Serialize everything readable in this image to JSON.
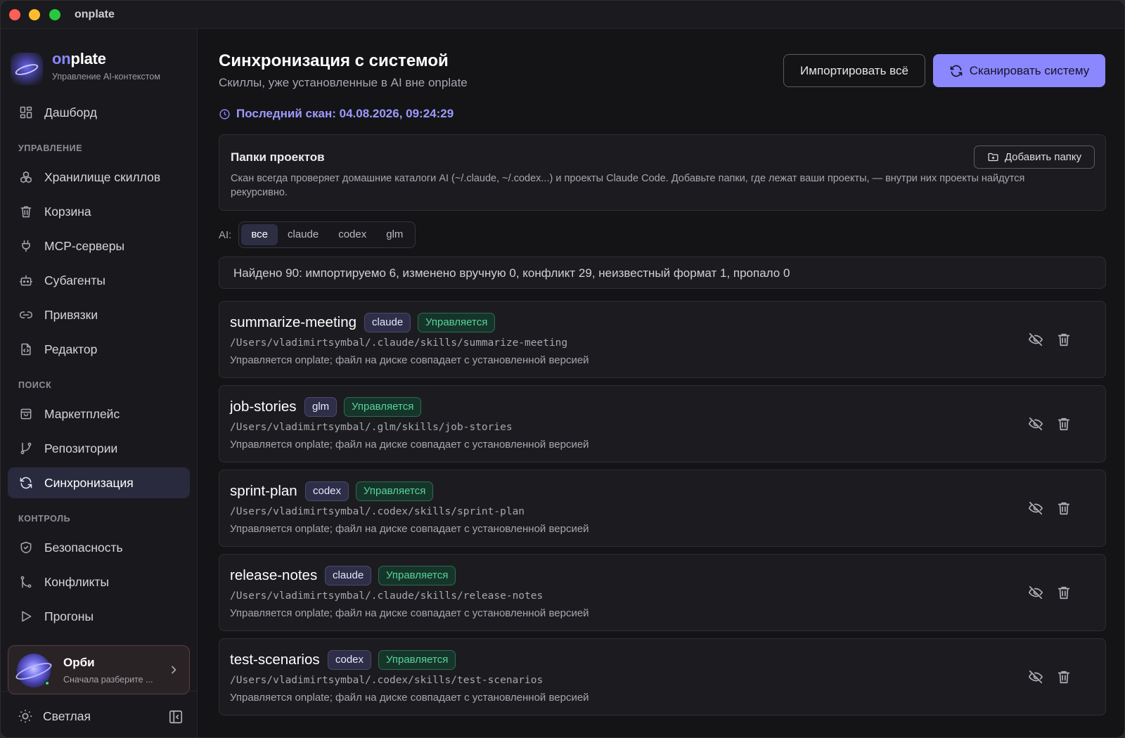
{
  "window": {
    "title": "onplate"
  },
  "brand": {
    "name_accent": "on",
    "name_rest": "plate",
    "subtitle": "Управление AI-контекстом"
  },
  "nav": {
    "dashboard": "Дашборд",
    "sections": {
      "manage": "УПРАВЛЕНИЕ",
      "search": "ПОИСК",
      "control": "КОНТРОЛЬ"
    },
    "items": [
      {
        "id": "skills-store",
        "label": "Хранилище скиллов",
        "icon": "cubes-icon"
      },
      {
        "id": "trash",
        "label": "Корзина",
        "icon": "trash-icon"
      },
      {
        "id": "mcp",
        "label": "MCP-серверы",
        "icon": "plug-icon"
      },
      {
        "id": "subagents",
        "label": "Субагенты",
        "icon": "bot-icon"
      },
      {
        "id": "bindings",
        "label": "Привязки",
        "icon": "link-icon"
      },
      {
        "id": "editor",
        "label": "Редактор",
        "icon": "file-code-icon"
      },
      {
        "id": "marketplace",
        "label": "Маркетплейс",
        "icon": "shopping-bag-icon"
      },
      {
        "id": "repos",
        "label": "Репозитории",
        "icon": "git-branch-icon"
      },
      {
        "id": "sync",
        "label": "Синхронизация",
        "icon": "refresh-icon",
        "active": true
      },
      {
        "id": "security",
        "label": "Безопасность",
        "icon": "shield-icon"
      },
      {
        "id": "conflicts",
        "label": "Конфликты",
        "icon": "git-merge-icon"
      },
      {
        "id": "runs",
        "label": "Прогоны",
        "icon": "play-icon"
      }
    ]
  },
  "orbi": {
    "name": "Орби",
    "subtitle": "Сначала разберите ..."
  },
  "theme": {
    "label": "Светлая"
  },
  "page": {
    "title": "Синхронизация с системой",
    "subtitle": "Скиллы, уже установленные в AI вне onplate",
    "import_all": "Импортировать всё",
    "scan": "Сканировать систему",
    "last_scan": "Последний скан: 04.08.2026, 09:24:29"
  },
  "folders": {
    "title": "Папки проектов",
    "add": "Добавить папку",
    "description": "Скан всегда проверяет домашние каталоги AI (~/.claude, ~/.codex...) и проекты Claude Code. Добавьте папки, где лежат ваши проекты, — внутри них проекты найдутся рекурсивно."
  },
  "filter": {
    "label": "AI:",
    "options": [
      "все",
      "claude",
      "codex",
      "glm"
    ],
    "selected": "все"
  },
  "summary": "Найдено 90: импортируемо 6, изменено вручную 0, конфликт 29, неизвестный формат 1, пропало 0",
  "skills": [
    {
      "name": "summarize-meeting",
      "ai": "claude",
      "status": "Управляется",
      "path": "/Users/vladimirtsymbal/.claude/skills/summarize-meeting",
      "desc": "Управляется onplate; файл на диске совпадает с установленной версией"
    },
    {
      "name": "job-stories",
      "ai": "glm",
      "status": "Управляется",
      "path": "/Users/vladimirtsymbal/.glm/skills/job-stories",
      "desc": "Управляется onplate; файл на диске совпадает с установленной версией"
    },
    {
      "name": "sprint-plan",
      "ai": "codex",
      "status": "Управляется",
      "path": "/Users/vladimirtsymbal/.codex/skills/sprint-plan",
      "desc": "Управляется onplate; файл на диске совпадает с установленной версией"
    },
    {
      "name": "release-notes",
      "ai": "claude",
      "status": "Управляется",
      "path": "/Users/vladimirtsymbal/.claude/skills/release-notes",
      "desc": "Управляется onplate; файл на диске совпадает с установленной версией"
    },
    {
      "name": "test-scenarios",
      "ai": "codex",
      "status": "Управляется",
      "path": "/Users/vladimirtsymbal/.codex/skills/test-scenarios",
      "desc": "Управляется onplate; файл на диске совпадает с установленной версией"
    }
  ],
  "colors": {
    "accent": "#8b87ff",
    "status_green": "#57d39a",
    "background": "#141417"
  }
}
